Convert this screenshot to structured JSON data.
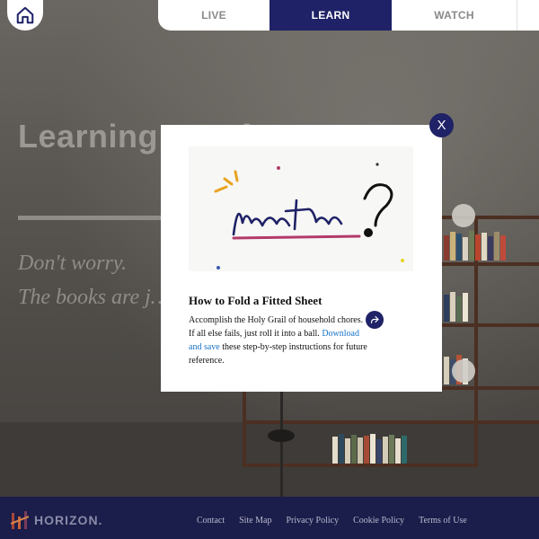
{
  "nav": {
    "home_icon": "home-icon",
    "tabs": [
      {
        "label": "LIVE"
      },
      {
        "label": "LEARN"
      },
      {
        "label": "WATCH"
      }
    ]
  },
  "hero": {
    "title": "Learning m… fun.",
    "subtitle_line1": "Don't worry.",
    "subtitle_line2": "The books are j…"
  },
  "modal": {
    "close_label": "X",
    "image_text": "how to?",
    "title": "How to Fold a Fitted Sheet",
    "body_before": "Accomplish the Holy Grail of household chores. If all else fails, just roll it into a ball.",
    "link_text": "Download and save",
    "body_after": "these step-by-step instructions for future reference.",
    "share_icon": "share-icon"
  },
  "footer": {
    "brand": "HORIZON.",
    "links": [
      "Contact",
      "Site Map",
      "Privacy Policy",
      "Cookie Policy",
      "Terms of Use"
    ]
  },
  "colors": {
    "accent": "#1f2266",
    "link": "#1a73c8",
    "footer_bg": "#1b1d4a"
  }
}
